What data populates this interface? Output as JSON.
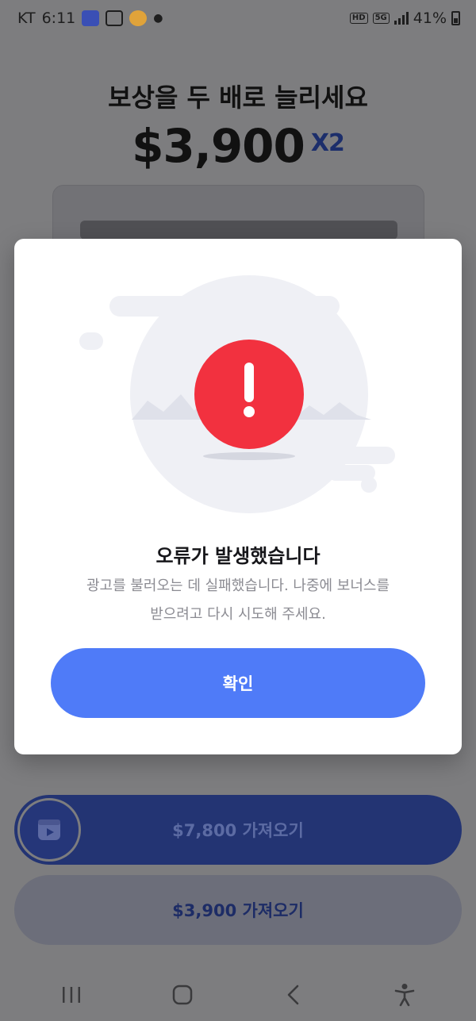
{
  "status_bar": {
    "carrier": "KT",
    "time": "6:11",
    "hd_label": "HD",
    "network_label": "5G",
    "battery_percent": "41%"
  },
  "background_page": {
    "title": "보상을 두 배로 늘리세요",
    "amount": "$3,900",
    "multiplier": "X2",
    "double_button_label": "$7,800 가져오기",
    "single_button_label": "$3,900 가져오기"
  },
  "error_dialog": {
    "title": "오류가 발생했습니다",
    "message_line1": "광고를 불러오는 데 실패했습니다. 나중에 보너스를",
    "message_line2": "받으려고 다시 시도해 주세요.",
    "confirm_label": "확인",
    "icon": "exclamation-alert-icon"
  },
  "colors": {
    "primary": "#4f7bf8",
    "alert": "#f2313f",
    "dark_button": "#233473"
  },
  "nav_bar": {
    "icons": [
      "recent-apps-icon",
      "home-icon",
      "back-icon",
      "accessibility-icon"
    ]
  }
}
